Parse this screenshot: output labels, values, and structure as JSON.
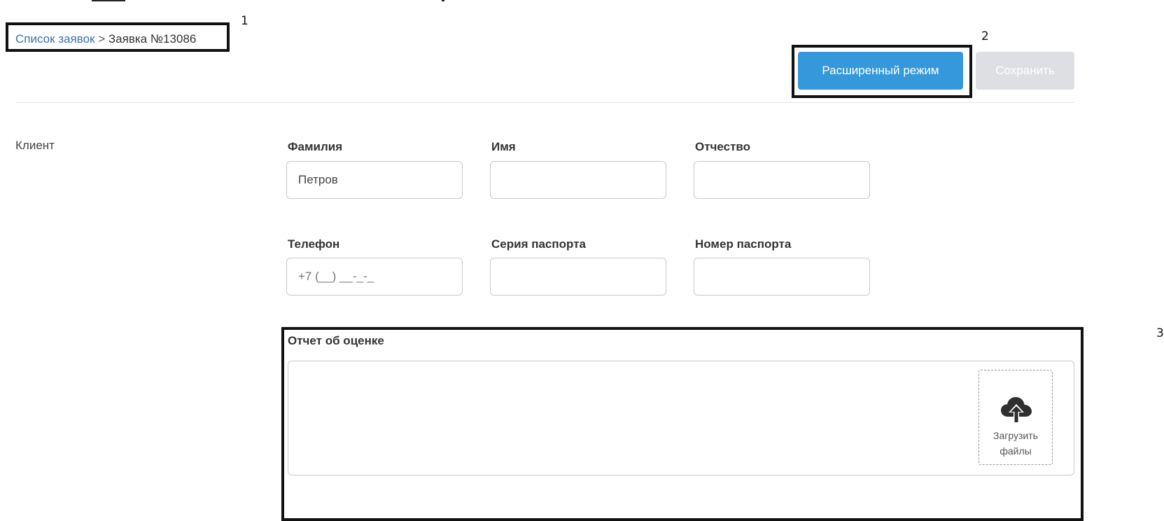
{
  "breadcrumb": {
    "list_link": "Список заявок",
    "separator": ">",
    "current": "Заявка №13086"
  },
  "callouts": [
    "1",
    "2",
    "3"
  ],
  "toolbar": {
    "advanced_mode_label": "Расширенный режим",
    "save_label": "Сохранить"
  },
  "client_section": {
    "label": "Клиент",
    "fields": {
      "last_name": {
        "label": "Фамилия",
        "value": "Петров"
      },
      "first_name": {
        "label": "Имя",
        "value": ""
      },
      "patronymic": {
        "label": "Отчество",
        "value": ""
      },
      "phone": {
        "label": "Телефон",
        "placeholder": "+7 (__) __-_-_"
      },
      "passport_series": {
        "label": "Серия паспорта",
        "value": ""
      },
      "passport_number": {
        "label": "Номер паспорта",
        "value": ""
      }
    }
  },
  "report": {
    "label": "Отчет об оценке",
    "upload_line1": "Загрузить",
    "upload_line2": "файлы",
    "upload_icon": "cloud-upload-icon"
  },
  "colors": {
    "primary_button": "#3498db",
    "disabled_button": "#dddfe2",
    "link": "#3b6fb0",
    "callout_border": "#111111"
  }
}
